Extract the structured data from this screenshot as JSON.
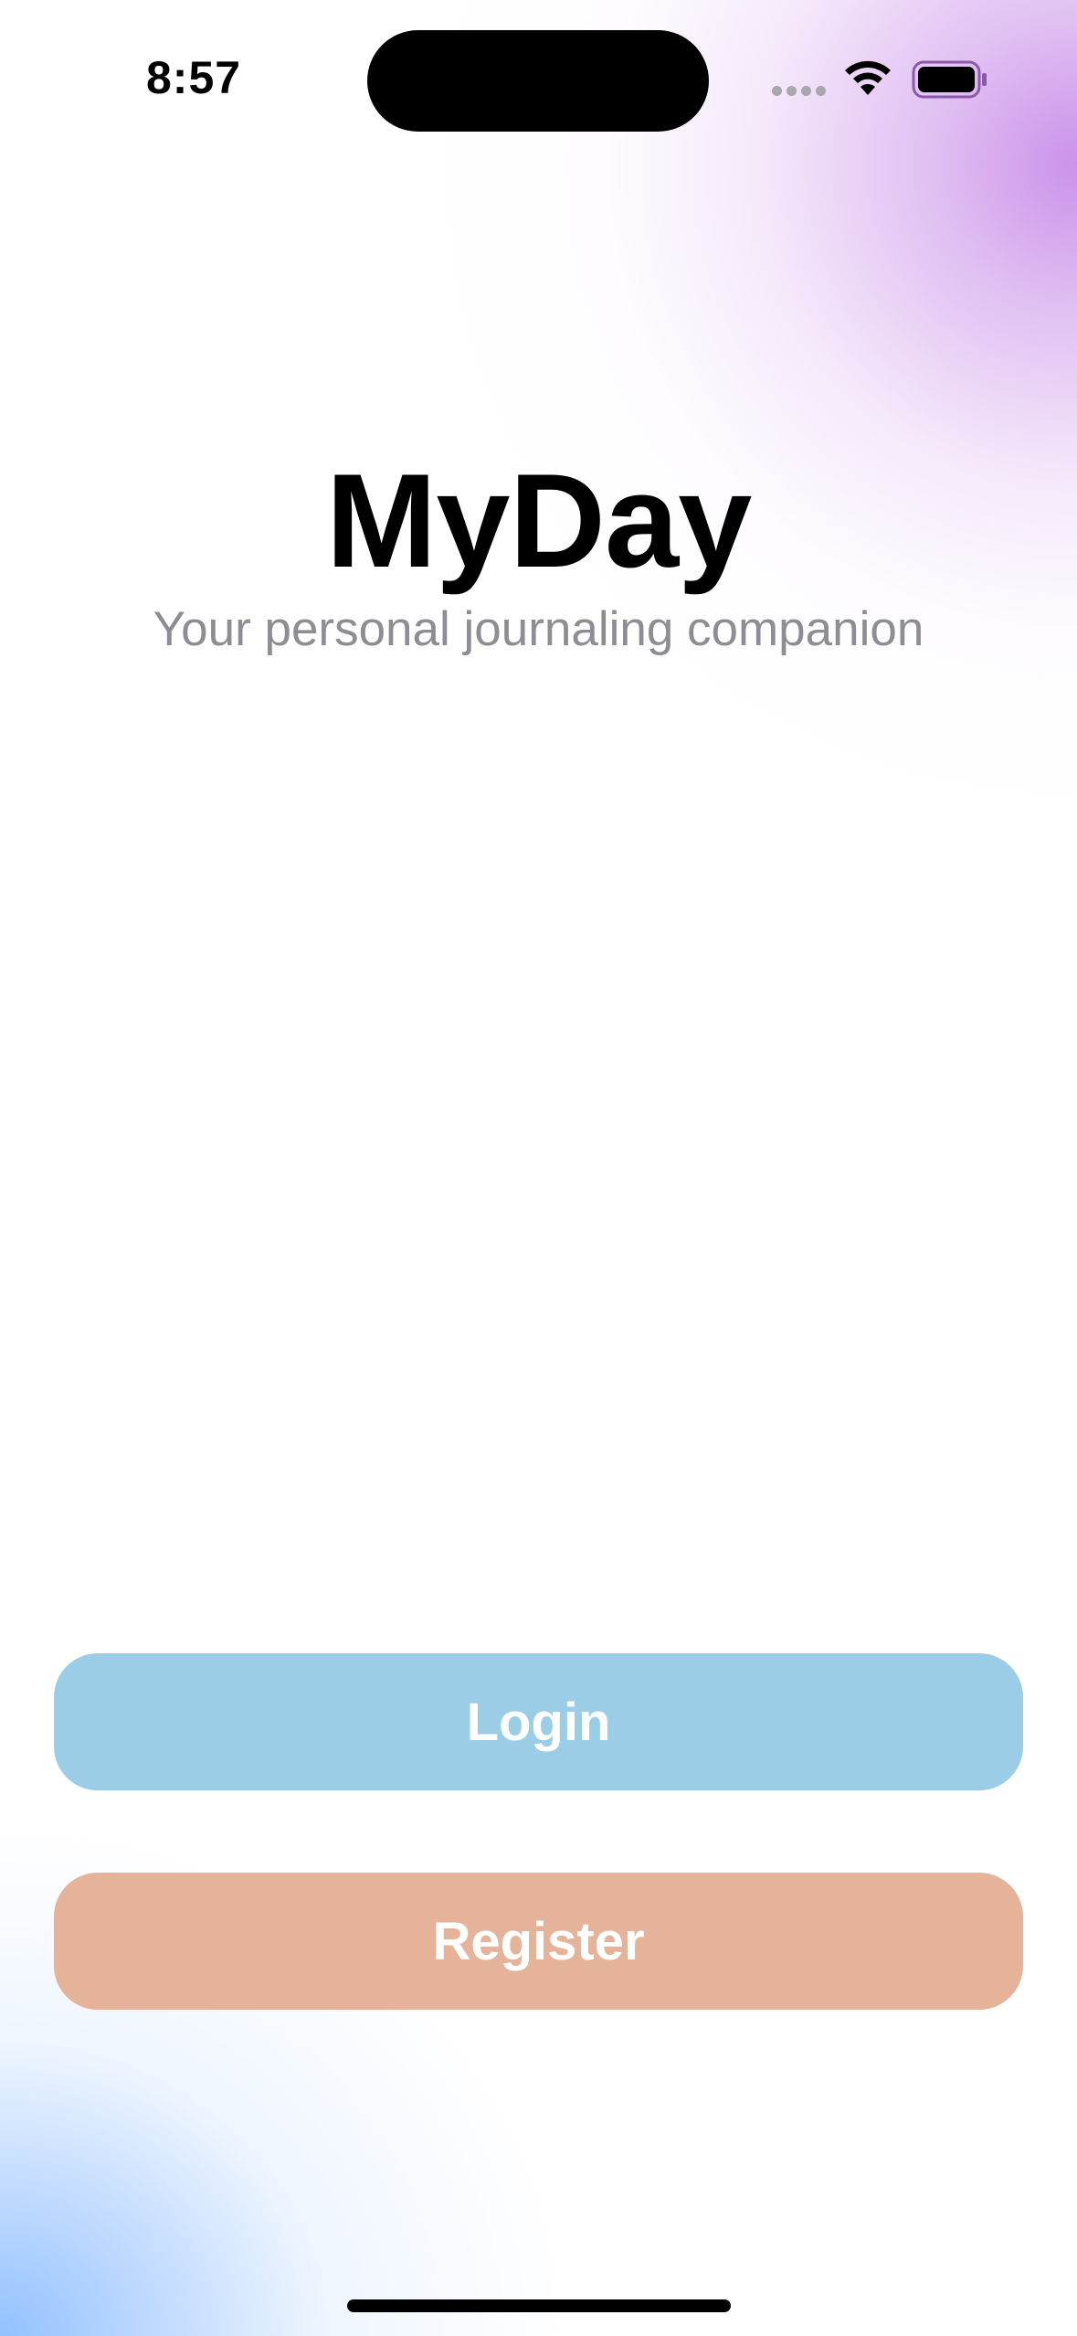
{
  "status_bar": {
    "time": "8:57",
    "icons": [
      "cellular-signal-icon",
      "wifi-icon",
      "battery-icon"
    ]
  },
  "app": {
    "title": "MyDay",
    "subtitle": "Your personal journaling companion"
  },
  "buttons": {
    "login_label": "Login",
    "register_label": "Register"
  },
  "colors": {
    "login_button": "#9bcde6",
    "register_button": "#e4b39a",
    "subtitle_text": "#8d8d93",
    "glow_top_right": "#c88ce8",
    "glow_bottom_left": "#8cbeff"
  }
}
